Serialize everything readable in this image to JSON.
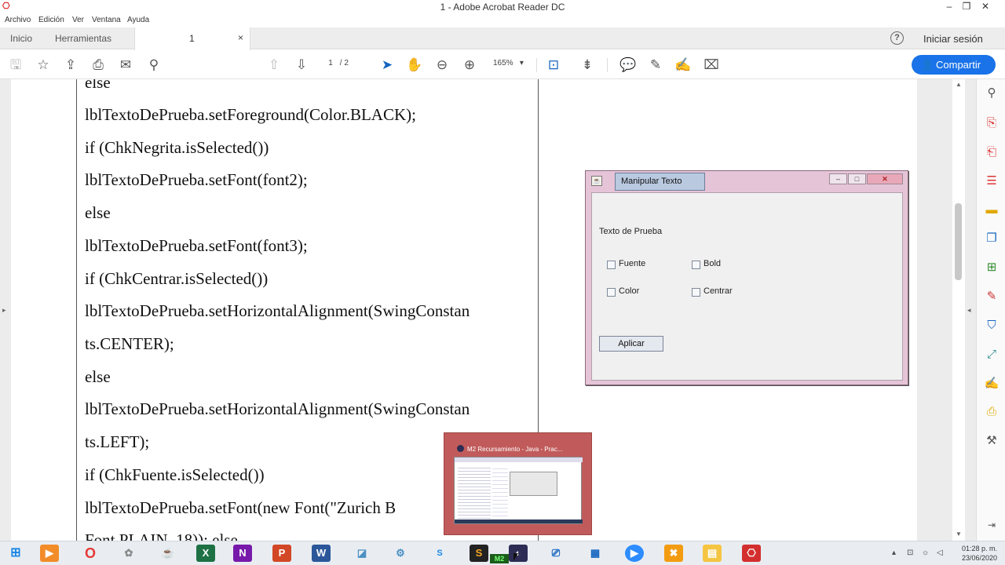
{
  "window": {
    "title": "1 - Adobe Acrobat Reader DC"
  },
  "menu": [
    "Archivo",
    "Edición",
    "Ver",
    "Ventana",
    "Ayuda"
  ],
  "tabs": {
    "home": "Inicio",
    "tools": "Herramientas",
    "document": "1",
    "close": "×",
    "sign_in": "Iniciar sesión",
    "help": "?"
  },
  "toolbar": {
    "page_current": "1",
    "page_total": "/ 2",
    "zoom": "165%",
    "share_label": "Compartir"
  },
  "document": {
    "code_lines": [
      "else",
      "lblTextoDePrueba.setForeground(Color.BLACK);",
      "if (ChkNegrita.isSelected())",
      "lblTextoDePrueba.setFont(font2);",
      "else",
      "lblTextoDePrueba.setFont(font3);",
      "if (ChkCentrar.isSelected())",
      "lblTextoDePrueba.setHorizontalAlignment(SwingConstan",
      "ts.CENTER);",
      "else",
      "lblTextoDePrueba.setHorizontalAlignment(SwingConstan",
      "ts.LEFT);",
      "if (ChkFuente.isSelected())",
      "lblTextoDePrueba.setFont(new Font(\"Zurich B",
      "Font.PLAIN, 18));  else"
    ]
  },
  "java_window": {
    "title": "Manipular Texto",
    "label": "Texto de Prueba",
    "checkboxes": {
      "fuente": "Fuente",
      "bold": "Bold",
      "color": "Color",
      "centrar": "Centrar"
    },
    "button": "Aplicar"
  },
  "taskbar_preview": {
    "title": "M2 Recursamiento - Java - Prac..."
  },
  "taskbar": {
    "m2_label": "M2",
    "time": "01:28 p. m.",
    "date": "23/06/2020"
  },
  "colors": {
    "accent": "#1a73e8",
    "java_frame": "#e6c4d8",
    "preview_bg": "#c15b5b"
  }
}
